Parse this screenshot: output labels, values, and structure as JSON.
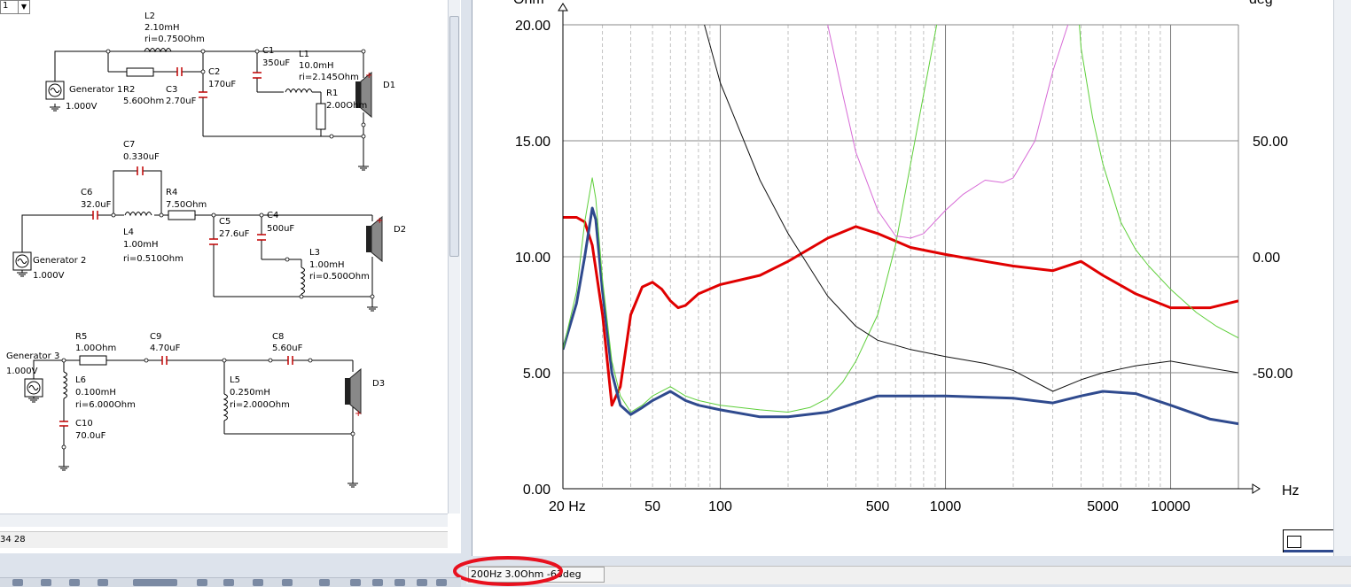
{
  "schematic": {
    "combo_value": "1",
    "status_text": "34  28",
    "components": {
      "gen1_name": "Generator 1",
      "gen1_v": "1.000V",
      "gen2_name": "Generator 2",
      "gen2_v": "1.000V",
      "gen3_name": "Generator 3",
      "gen3_v": "1.000V",
      "L2_name": "L2",
      "L2_val": "2.10mH",
      "L2_ri": "ri=0.750Ohm",
      "R2_name": "R2",
      "R2_val": "5.60Ohm",
      "C3_name": "C3",
      "C3_val": "2.70uF",
      "C2_name": "C2",
      "C2_val": "170uF",
      "C1_name": "C1",
      "C1_val": "350uF",
      "L1_name": "L1",
      "L1_val": "10.0mH",
      "L1_ri": "ri=2.145Ohm",
      "R1_name": "R1",
      "R1_val": "2.00Ohm",
      "D1": "D1",
      "C7_name": "C7",
      "C7_val": "0.330uF",
      "C6_name": "C6",
      "C6_val": "32.0uF",
      "R4_name": "R4",
      "R4_val": "7.50Ohm",
      "L4_name": "L4",
      "L4_val": "1.00mH",
      "L4_ri": "ri=0.510Ohm",
      "C5_name": "C5",
      "C5_val": "27.6uF",
      "C4_name": "C4",
      "C4_val": "500uF",
      "L3_name": "L3",
      "L3_val": "1.00mH",
      "L3_ri": "ri=0.500Ohm",
      "D2": "D2",
      "R5_name": "R5",
      "R5_val": "1.00Ohm",
      "C9_name": "C9",
      "C9_val": "4.70uF",
      "C8_name": "C8",
      "C8_val": "5.60uF",
      "L6_name": "L6",
      "L6_val": "0.100mH",
      "L6_ri": "ri=6.000Ohm",
      "C10_name": "C10",
      "C10_val": "70.0uF",
      "L5_name": "L5",
      "L5_val": "0.250mH",
      "L5_ri": "ri=2.000Ohm",
      "D3": "D3"
    }
  },
  "graph": {
    "status_readout": "200Hz 3.0Ohm -63deg",
    "highlight_color": "#e8101e"
  },
  "chart_data": {
    "type": "line",
    "x_scale": "log",
    "x_range": [
      20,
      20000
    ],
    "x_tick_labels": [
      "20 Hz",
      "50",
      "100",
      "500",
      "1000",
      "5000",
      "10000"
    ],
    "x_unit": "Hz",
    "y_left_unit": "Ohm",
    "y_left_range": [
      0,
      20
    ],
    "y_left_ticks": [
      "20.00",
      "15.00",
      "10.00",
      "5.00",
      "0.00"
    ],
    "y_right_unit": "deg",
    "y_right_ticks": [
      "50.00",
      "0.00",
      "-50.00"
    ],
    "y_right_range": [
      -100,
      100
    ],
    "grid": true,
    "series": [
      {
        "color": "#e00000",
        "axis": "left",
        "width": 3,
        "x": [
          20,
          23,
          25,
          27,
          30,
          33,
          36,
          40,
          45,
          50,
          55,
          60,
          65,
          70,
          80,
          100,
          150,
          200,
          300,
          400,
          500,
          700,
          1000,
          1500,
          2000,
          3000,
          4000,
          5000,
          7000,
          10000,
          15000,
          20000
        ],
        "y": [
          11.7,
          11.7,
          11.5,
          10.5,
          7.5,
          3.6,
          4.4,
          7.5,
          8.7,
          8.9,
          8.6,
          8.1,
          7.8,
          7.9,
          8.4,
          8.8,
          9.2,
          9.8,
          10.8,
          11.3,
          11.0,
          10.4,
          10.1,
          9.8,
          9.6,
          9.4,
          9.8,
          9.2,
          8.4,
          7.8,
          7.8,
          8.1
        ]
      },
      {
        "color": "#2f4a8e",
        "axis": "left",
        "width": 3,
        "x": [
          20,
          23,
          25,
          27,
          28,
          30,
          33,
          36,
          40,
          45,
          50,
          60,
          70,
          80,
          100,
          150,
          200,
          300,
          400,
          500,
          1000,
          2000,
          3000,
          4000,
          5000,
          7000,
          10000,
          15000,
          20000
        ],
        "y": [
          6.0,
          8.0,
          10.0,
          12.1,
          11.6,
          8.5,
          5.0,
          3.6,
          3.2,
          3.5,
          3.8,
          4.2,
          3.8,
          3.6,
          3.4,
          3.1,
          3.1,
          3.3,
          3.7,
          4.0,
          4.0,
          3.9,
          3.7,
          4.0,
          4.2,
          4.1,
          3.6,
          3.0,
          2.8
        ]
      },
      {
        "color": "#5ecf3a",
        "axis": "left",
        "width": 1,
        "x": [
          20,
          23,
          25,
          27,
          28,
          30,
          33,
          36,
          40,
          45,
          50,
          60,
          70,
          80,
          100,
          150,
          200,
          250,
          300,
          350,
          400,
          500,
          600,
          700,
          800,
          1000,
          1200
        ],
        "y": [
          6.0,
          8.5,
          11.5,
          13.4,
          12.5,
          9.0,
          5.5,
          4.0,
          3.3,
          3.6,
          4.0,
          4.4,
          4.0,
          3.8,
          3.6,
          3.4,
          3.3,
          3.5,
          3.9,
          4.6,
          5.5,
          7.5,
          10.5,
          14.0,
          17.0,
          22.0,
          25.0
        ]
      },
      {
        "color": "#5ecf3a",
        "axis": "left",
        "width": 1,
        "x": [
          3800,
          4000,
          4500,
          5000,
          6000,
          7000,
          8000,
          10000,
          13000,
          16000,
          20000
        ],
        "y": [
          22.0,
          19.0,
          16.0,
          14.0,
          11.5,
          10.3,
          9.6,
          8.6,
          7.6,
          7.0,
          6.5
        ]
      },
      {
        "color": "#111111",
        "axis": "left",
        "width": 1,
        "x": [
          85,
          100,
          150,
          200,
          300,
          400,
          500,
          700,
          1000,
          1500,
          2000,
          3000,
          4000,
          5000,
          7000,
          10000,
          15000,
          20000
        ],
        "y": [
          20.0,
          17.5,
          13.3,
          11.0,
          8.3,
          7.0,
          6.4,
          6.0,
          5.7,
          5.4,
          5.1,
          4.2,
          4.7,
          5.0,
          5.3,
          5.5,
          5.2,
          5.0
        ]
      },
      {
        "color": "#d76ad6",
        "axis": "left",
        "width": 1,
        "x": [
          300,
          350,
          400,
          500,
          600,
          700,
          800,
          1000,
          1200,
          1500,
          1800,
          2000,
          2500,
          3000,
          3500
        ],
        "y": [
          20.0,
          17.0,
          14.5,
          12.0,
          10.9,
          10.8,
          11.0,
          12.0,
          12.7,
          13.3,
          13.2,
          13.4,
          15.0,
          18.0,
          20.0
        ]
      }
    ]
  }
}
